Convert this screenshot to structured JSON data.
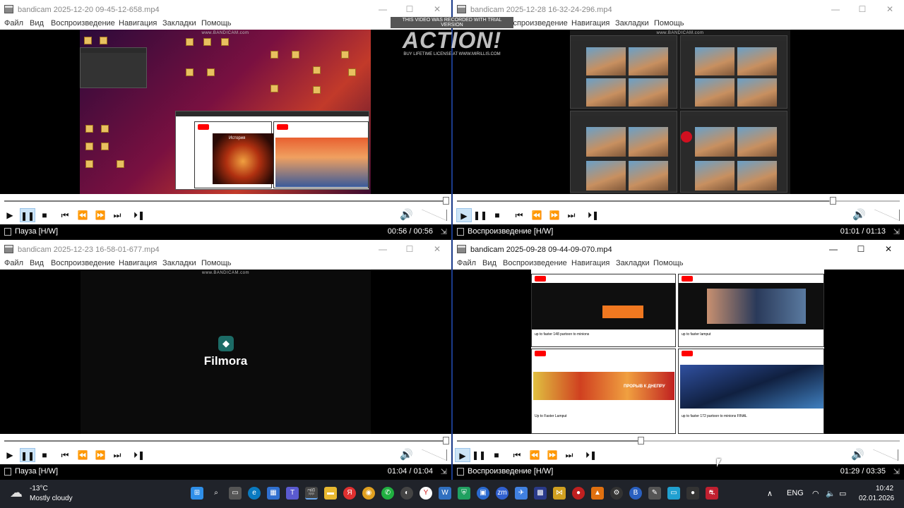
{
  "menu": [
    "Файл",
    "Вид",
    "Воспроизведение",
    "Навигация",
    "Закладки",
    "Помощь"
  ],
  "window_buttons": {
    "minimize": "—",
    "maximize": "☐",
    "close": "✕"
  },
  "windows": [
    {
      "title": "bandicam 2025-12-20 09-45-12-658.mp4",
      "status": "Пауза [H/W]",
      "time": "00:56 / 00:56",
      "progress": 1.0,
      "paused": true
    },
    {
      "title": "bandicam 2025-12-28 16-32-24-296.mp4",
      "status": "Воспроизведение [H/W]",
      "time": "01:01 / 01:13",
      "progress": 0.84,
      "paused": false
    },
    {
      "title": "bandicam 2025-12-23 16-58-01-677.mp4",
      "status": "Пауза [H/W]",
      "time": "01:04 / 01:04",
      "progress": 1.0,
      "paused": true
    },
    {
      "title": "bandicam 2025-09-28 09-44-09-070.mp4",
      "status": "Воспроизведение [H/W]",
      "time": "01:29 / 03:35",
      "progress": 0.41,
      "paused": false
    }
  ],
  "video": {
    "bandicam_tag": "www.BANDICAM.com",
    "filmora": "Filmora",
    "history_label": "История",
    "tiles_w3": [
      "up to faster 148 partoon to minions",
      "up to faster lamput",
      "Up to Faster Lamput",
      "up to faster 172 partoon to minions FINAL"
    ],
    "proryv": "ПРОРЫВ К ДНЕПРУ"
  },
  "watermark": {
    "top": "THIS VIDEO WAS RECORDED WITH TRIAL VERSION",
    "big": "ACTION!",
    "bottom": "BUY LIFETIME LICENSE AT WWW.MIRILLIS.COM"
  },
  "taskbar": {
    "weather_temp": "-13°C",
    "weather_desc": "Mostly cloudy",
    "lang": "ENG",
    "time": "10:42",
    "date": "02.01.2026",
    "icons": [
      "start-icon",
      "search-icon",
      "task-view-icon",
      "edge-icon",
      "store-icon",
      "teams-icon",
      "bandicam-icon",
      "explorer-icon",
      "yandex-icon",
      "chrome-icon",
      "whatsapp-icon",
      "yandex-browser-icon",
      "notepad-icon",
      "vpn-icon",
      "zoom-icon",
      "app-icon",
      "flag-icon",
      "mail-icon",
      "record-icon",
      "vlc-icon",
      "steam-icon",
      "bitwarden-icon",
      "settings-icon",
      "screen-icon",
      "media-icon",
      "app-red-icon"
    ]
  }
}
